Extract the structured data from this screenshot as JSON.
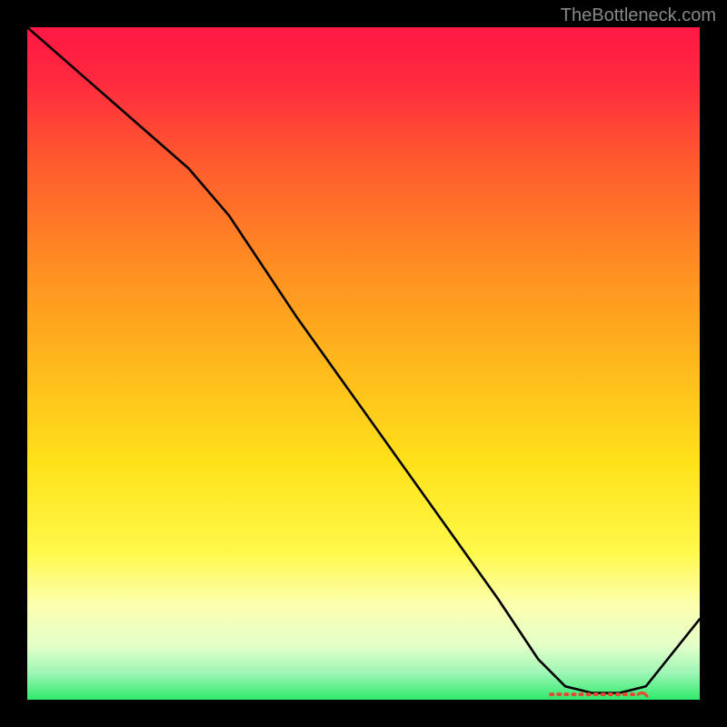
{
  "watermark": {
    "text": "TheBottleneck.com"
  },
  "chart_data": {
    "type": "line",
    "title": "",
    "xlabel": "",
    "ylabel": "",
    "xlim": [
      0,
      100
    ],
    "ylim": [
      0,
      100
    ],
    "gradient_stops": [
      {
        "offset": 0.0,
        "color": "#ff1744"
      },
      {
        "offset": 0.08,
        "color": "#ff2a3f"
      },
      {
        "offset": 0.2,
        "color": "#ff5a2e"
      },
      {
        "offset": 0.35,
        "color": "#ff8c22"
      },
      {
        "offset": 0.5,
        "color": "#ffb81c"
      },
      {
        "offset": 0.65,
        "color": "#ffe21a"
      },
      {
        "offset": 0.78,
        "color": "#fff94a"
      },
      {
        "offset": 0.86,
        "color": "#fcffb0"
      },
      {
        "offset": 0.92,
        "color": "#e4ffc9"
      },
      {
        "offset": 0.96,
        "color": "#9ef7b6"
      },
      {
        "offset": 1.0,
        "color": "#2ee86b"
      }
    ],
    "series": [
      {
        "name": "bottleneck-curve",
        "x": [
          0,
          8,
          16,
          24,
          30,
          40,
          50,
          60,
          70,
          76,
          80,
          84,
          88,
          92,
          100
        ],
        "y": [
          100,
          93,
          86,
          79,
          72,
          57,
          43,
          29,
          15,
          6,
          2,
          1,
          1,
          2,
          12
        ]
      }
    ],
    "markers": {
      "name": "trough-markers",
      "color": "#e34a33",
      "x_start": 78,
      "x_end": 90,
      "y": 0.8
    }
  }
}
